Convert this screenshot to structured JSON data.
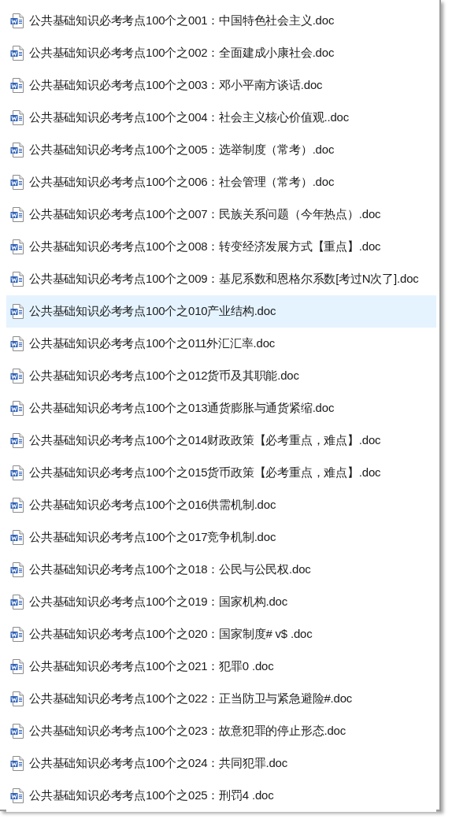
{
  "files": [
    {
      "name": "公共基础知识必考考点100个之001：中国特色社会主义.doc",
      "selected": false
    },
    {
      "name": "公共基础知识必考考点100个之002：全面建成小康社会.doc",
      "selected": false
    },
    {
      "name": "公共基础知识必考考点100个之003：邓小平南方谈话.doc",
      "selected": false
    },
    {
      "name": "公共基础知识必考考点100个之004：社会主义核心价值观..doc",
      "selected": false
    },
    {
      "name": "公共基础知识必考考点100个之005：选举制度（常考）.doc",
      "selected": false
    },
    {
      "name": "公共基础知识必考考点100个之006：社会管理（常考）.doc",
      "selected": false
    },
    {
      "name": "公共基础知识必考考点100个之007：民族关系问题（今年热点）.doc",
      "selected": false
    },
    {
      "name": "公共基础知识必考考点100个之008：转变经济发展方式【重点】.doc",
      "selected": false
    },
    {
      "name": "公共基础知识必考考点100个之009：基尼系数和恩格尔系数[考过N次了].doc",
      "selected": false
    },
    {
      "name": "公共基础知识必考考点100个之010产业结构.doc",
      "selected": true
    },
    {
      "name": "公共基础知识必考考点100个之011外汇汇率.doc",
      "selected": false
    },
    {
      "name": "公共基础知识必考考点100个之012货币及其职能.doc",
      "selected": false
    },
    {
      "name": "公共基础知识必考考点100个之013通货膨胀与通货紧缩.doc",
      "selected": false
    },
    {
      "name": "公共基础知识必考考点100个之014财政政策【必考重点，难点】.doc",
      "selected": false
    },
    {
      "name": "公共基础知识必考考点100个之015货币政策【必考重点，难点】.doc",
      "selected": false
    },
    {
      "name": "公共基础知识必考考点100个之016供需机制.doc",
      "selected": false
    },
    {
      "name": "公共基础知识必考考点100个之017竞争机制.doc",
      "selected": false
    },
    {
      "name": "公共基础知识必考考点100个之018：公民与公民权.doc",
      "selected": false
    },
    {
      "name": "公共基础知识必考考点100个之019：国家机构.doc",
      "selected": false
    },
    {
      "name": "公共基础知识必考考点100个之020：国家制度# v$ .doc",
      "selected": false
    },
    {
      "name": "公共基础知识必考考点100个之021：犯罪0 .doc",
      "selected": false
    },
    {
      "name": "公共基础知识必考考点100个之022：正当防卫与紧急避险#.doc",
      "selected": false
    },
    {
      "name": "公共基础知识必考考点100个之023：故意犯罪的停止形态.doc",
      "selected": false
    },
    {
      "name": "公共基础知识必考考点100个之024：共同犯罪.doc",
      "selected": false
    },
    {
      "name": "公共基础知识必考考点100个之025：刑罚4 .doc",
      "selected": false
    }
  ]
}
